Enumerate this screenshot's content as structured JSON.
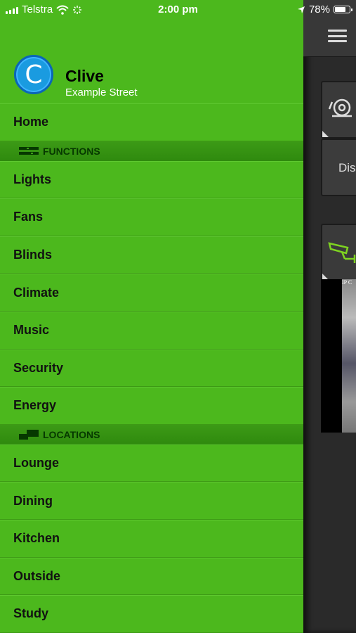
{
  "status_bar": {
    "carrier": "Telstra",
    "time": "2:00 pm",
    "battery": "78%",
    "battery_level": 0.78
  },
  "profile": {
    "avatar_letter": "C",
    "name": "Clive",
    "address": "Example Street"
  },
  "menu": {
    "home": "Home",
    "functions_header": "FUNCTIONS",
    "functions": [
      "Lights",
      "Fans",
      "Blinds",
      "Climate",
      "Music",
      "Security",
      "Energy"
    ],
    "locations_header": "LOCATIONS",
    "locations": [
      "Lounge",
      "Dining",
      "Kitchen",
      "Outside",
      "Study"
    ]
  },
  "background_panel": {
    "tile_label": "Dis",
    "camera_caption": "IP C"
  },
  "colors": {
    "drawer": "#4cb81d",
    "section_header": "#2f8a0e",
    "avatar": "#1a9be0",
    "camera_icon": "#7ed321"
  },
  "icons": [
    "wifi-icon",
    "activity-spinner-icon",
    "location-arrow-icon",
    "functions-icon",
    "locations-icon",
    "hamburger-menu-icon",
    "alarm-bell-icon",
    "security-camera-icon"
  ]
}
